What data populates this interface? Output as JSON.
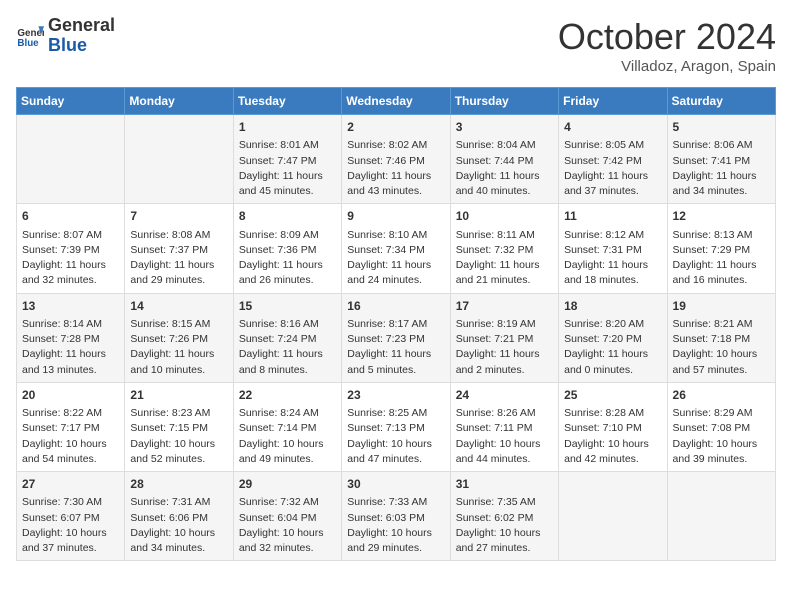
{
  "header": {
    "logo_general": "General",
    "logo_blue": "Blue",
    "month_title": "October 2024",
    "location": "Villadoz, Aragon, Spain"
  },
  "days_of_week": [
    "Sunday",
    "Monday",
    "Tuesday",
    "Wednesday",
    "Thursday",
    "Friday",
    "Saturday"
  ],
  "weeks": [
    [
      {
        "day": "",
        "content": ""
      },
      {
        "day": "",
        "content": ""
      },
      {
        "day": "1",
        "content": "Sunrise: 8:01 AM\nSunset: 7:47 PM\nDaylight: 11 hours and 45 minutes."
      },
      {
        "day": "2",
        "content": "Sunrise: 8:02 AM\nSunset: 7:46 PM\nDaylight: 11 hours and 43 minutes."
      },
      {
        "day": "3",
        "content": "Sunrise: 8:04 AM\nSunset: 7:44 PM\nDaylight: 11 hours and 40 minutes."
      },
      {
        "day": "4",
        "content": "Sunrise: 8:05 AM\nSunset: 7:42 PM\nDaylight: 11 hours and 37 minutes."
      },
      {
        "day": "5",
        "content": "Sunrise: 8:06 AM\nSunset: 7:41 PM\nDaylight: 11 hours and 34 minutes."
      }
    ],
    [
      {
        "day": "6",
        "content": "Sunrise: 8:07 AM\nSunset: 7:39 PM\nDaylight: 11 hours and 32 minutes."
      },
      {
        "day": "7",
        "content": "Sunrise: 8:08 AM\nSunset: 7:37 PM\nDaylight: 11 hours and 29 minutes."
      },
      {
        "day": "8",
        "content": "Sunrise: 8:09 AM\nSunset: 7:36 PM\nDaylight: 11 hours and 26 minutes."
      },
      {
        "day": "9",
        "content": "Sunrise: 8:10 AM\nSunset: 7:34 PM\nDaylight: 11 hours and 24 minutes."
      },
      {
        "day": "10",
        "content": "Sunrise: 8:11 AM\nSunset: 7:32 PM\nDaylight: 11 hours and 21 minutes."
      },
      {
        "day": "11",
        "content": "Sunrise: 8:12 AM\nSunset: 7:31 PM\nDaylight: 11 hours and 18 minutes."
      },
      {
        "day": "12",
        "content": "Sunrise: 8:13 AM\nSunset: 7:29 PM\nDaylight: 11 hours and 16 minutes."
      }
    ],
    [
      {
        "day": "13",
        "content": "Sunrise: 8:14 AM\nSunset: 7:28 PM\nDaylight: 11 hours and 13 minutes."
      },
      {
        "day": "14",
        "content": "Sunrise: 8:15 AM\nSunset: 7:26 PM\nDaylight: 11 hours and 10 minutes."
      },
      {
        "day": "15",
        "content": "Sunrise: 8:16 AM\nSunset: 7:24 PM\nDaylight: 11 hours and 8 minutes."
      },
      {
        "day": "16",
        "content": "Sunrise: 8:17 AM\nSunset: 7:23 PM\nDaylight: 11 hours and 5 minutes."
      },
      {
        "day": "17",
        "content": "Sunrise: 8:19 AM\nSunset: 7:21 PM\nDaylight: 11 hours and 2 minutes."
      },
      {
        "day": "18",
        "content": "Sunrise: 8:20 AM\nSunset: 7:20 PM\nDaylight: 11 hours and 0 minutes."
      },
      {
        "day": "19",
        "content": "Sunrise: 8:21 AM\nSunset: 7:18 PM\nDaylight: 10 hours and 57 minutes."
      }
    ],
    [
      {
        "day": "20",
        "content": "Sunrise: 8:22 AM\nSunset: 7:17 PM\nDaylight: 10 hours and 54 minutes."
      },
      {
        "day": "21",
        "content": "Sunrise: 8:23 AM\nSunset: 7:15 PM\nDaylight: 10 hours and 52 minutes."
      },
      {
        "day": "22",
        "content": "Sunrise: 8:24 AM\nSunset: 7:14 PM\nDaylight: 10 hours and 49 minutes."
      },
      {
        "day": "23",
        "content": "Sunrise: 8:25 AM\nSunset: 7:13 PM\nDaylight: 10 hours and 47 minutes."
      },
      {
        "day": "24",
        "content": "Sunrise: 8:26 AM\nSunset: 7:11 PM\nDaylight: 10 hours and 44 minutes."
      },
      {
        "day": "25",
        "content": "Sunrise: 8:28 AM\nSunset: 7:10 PM\nDaylight: 10 hours and 42 minutes."
      },
      {
        "day": "26",
        "content": "Sunrise: 8:29 AM\nSunset: 7:08 PM\nDaylight: 10 hours and 39 minutes."
      }
    ],
    [
      {
        "day": "27",
        "content": "Sunrise: 7:30 AM\nSunset: 6:07 PM\nDaylight: 10 hours and 37 minutes."
      },
      {
        "day": "28",
        "content": "Sunrise: 7:31 AM\nSunset: 6:06 PM\nDaylight: 10 hours and 34 minutes."
      },
      {
        "day": "29",
        "content": "Sunrise: 7:32 AM\nSunset: 6:04 PM\nDaylight: 10 hours and 32 minutes."
      },
      {
        "day": "30",
        "content": "Sunrise: 7:33 AM\nSunset: 6:03 PM\nDaylight: 10 hours and 29 minutes."
      },
      {
        "day": "31",
        "content": "Sunrise: 7:35 AM\nSunset: 6:02 PM\nDaylight: 10 hours and 27 minutes."
      },
      {
        "day": "",
        "content": ""
      },
      {
        "day": "",
        "content": ""
      }
    ]
  ]
}
